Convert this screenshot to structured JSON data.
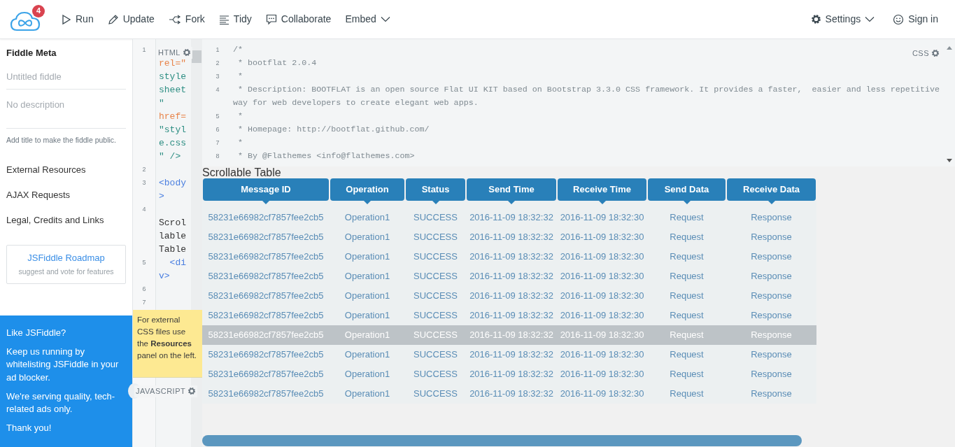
{
  "navbar": {
    "badge": "4",
    "actions": [
      {
        "label": "Run"
      },
      {
        "label": "Update"
      },
      {
        "label": "Fork"
      },
      {
        "label": "Tidy"
      },
      {
        "label": "Collaborate"
      },
      {
        "label": "Embed",
        "caret": true
      }
    ],
    "right": [
      {
        "label": "Settings",
        "caret": true
      },
      {
        "label": "Sign in"
      }
    ]
  },
  "sidebar": {
    "heading": "Fiddle Meta",
    "title_placeholder": "Untitled fiddle",
    "description_placeholder": "No description",
    "hint": "Add title to make the fiddle public.",
    "links": [
      "External Resources",
      "AJAX Requests",
      "Legal, Credits and Links"
    ],
    "roadmap": {
      "title": "JSFiddle Roadmap",
      "subtitle": "suggest and vote for features"
    }
  },
  "ad": {
    "paragraphs": [
      "Like JSFiddle?",
      "Keep us running by whitelisting JSFiddle in your ad blocker.",
      "We're serving quality, tech-related ads only.",
      "Thank you!"
    ]
  },
  "html_editor": {
    "label": "HTML",
    "lines": [
      {
        "number": "1",
        "rows": [
          {
            "kind": "blank"
          },
          {
            "kind": "attr",
            "text": "rel=\""
          },
          {
            "kind": "string",
            "text": "style"
          },
          {
            "kind": "string",
            "text": "sheet"
          },
          {
            "kind": "string",
            "text": "\""
          },
          {
            "kind": "attr",
            "text": "href="
          },
          {
            "kind": "string",
            "text": "\"styl"
          },
          {
            "kind": "string",
            "text": "e.css"
          },
          {
            "kind": "string",
            "text": "\" />"
          }
        ]
      },
      {
        "number": "2"
      },
      {
        "number": "3",
        "rows": [
          {
            "kind": "tag",
            "text": "<body"
          },
          {
            "kind": "tag",
            "text": ">"
          }
        ]
      },
      {
        "number": "4",
        "rows": [
          {
            "kind": "blank"
          },
          {
            "kind": "text",
            "text": "Scrol"
          },
          {
            "kind": "text",
            "text": "lable"
          },
          {
            "kind": "text",
            "text": "Table"
          }
        ]
      },
      {
        "number": "5",
        "rows": [
          {
            "kind": "tag",
            "text": "  <di"
          },
          {
            "kind": "tag",
            "text": "v>"
          }
        ]
      },
      {
        "number": "6"
      },
      {
        "number": "7"
      }
    ]
  },
  "tooltip": {
    "text": "For external CSS files use the **Resources** panel on the left."
  },
  "js_editor": {
    "label": "JAVASCRIPT"
  },
  "css_editor": {
    "label": "CSS",
    "lines": [
      {
        "number": "1",
        "rows": [
          "/*"
        ]
      },
      {
        "number": "2",
        "rows": [
          " * bootflat 2.0.4"
        ]
      },
      {
        "number": "3",
        "rows": [
          " *"
        ]
      },
      {
        "number": "4",
        "rows": [
          " * Description: BOOTFLAT is an open source Flat UI KIT based on Bootstrap 3.3.0 CSS framework. It provides a faster,  easier and less repetitive",
          "way for web developers to create elegant web apps."
        ]
      },
      {
        "number": "5",
        "rows": [
          " *"
        ]
      },
      {
        "number": "6",
        "rows": [
          " * Homepage: http://bootflat.github.com/"
        ]
      },
      {
        "number": "7",
        "rows": [
          " *"
        ]
      },
      {
        "number": "8",
        "rows": [
          " * By @Flathemes <info@flathemes.com>"
        ]
      }
    ]
  },
  "output": {
    "title": "Scrollable Table",
    "table": {
      "columns": [
        "Message ID",
        "Operation",
        "Status",
        "Send Time",
        "Receive Time",
        "Send Data",
        "Receive Data"
      ],
      "rows": [
        {
          "selected": false,
          "cells": [
            "58231e66982cf7857fee2cb5",
            "Operation1",
            "SUCCESS",
            "2016-11-09 18:32:32",
            "2016-11-09 18:32:30",
            "Request",
            "Response"
          ]
        },
        {
          "selected": false,
          "cells": [
            "58231e66982cf7857fee2cb5",
            "Operation1",
            "SUCCESS",
            "2016-11-09 18:32:32",
            "2016-11-09 18:32:30",
            "Request",
            "Response"
          ]
        },
        {
          "selected": false,
          "cells": [
            "58231e66982cf7857fee2cb5",
            "Operation1",
            "SUCCESS",
            "2016-11-09 18:32:32",
            "2016-11-09 18:32:30",
            "Request",
            "Response"
          ]
        },
        {
          "selected": false,
          "cells": [
            "58231e66982cf7857fee2cb5",
            "Operation1",
            "SUCCESS",
            "2016-11-09 18:32:32",
            "2016-11-09 18:32:30",
            "Request",
            "Response"
          ]
        },
        {
          "selected": false,
          "cells": [
            "58231e66982cf7857fee2cb5",
            "Operation1",
            "SUCCESS",
            "2016-11-09 18:32:32",
            "2016-11-09 18:32:30",
            "Request",
            "Response"
          ]
        },
        {
          "selected": false,
          "cells": [
            "58231e66982cf7857fee2cb5",
            "Operation1",
            "SUCCESS",
            "2016-11-09 18:32:32",
            "2016-11-09 18:32:30",
            "Request",
            "Response"
          ]
        },
        {
          "selected": true,
          "cells": [
            "58231e66982cf7857fee2cb5",
            "Operation1",
            "SUCCESS",
            "2016-11-09 18:32:32",
            "2016-11-09 18:32:30",
            "Request",
            "Response"
          ]
        },
        {
          "selected": false,
          "cells": [
            "58231e66982cf7857fee2cb5",
            "Operation1",
            "SUCCESS",
            "2016-11-09 18:32:32",
            "2016-11-09 18:32:30",
            "Request",
            "Response"
          ]
        },
        {
          "selected": false,
          "cells": [
            "58231e66982cf7857fee2cb5",
            "Operation1",
            "SUCCESS",
            "2016-11-09 18:32:32",
            "2016-11-09 18:32:30",
            "Request",
            "Response"
          ]
        },
        {
          "selected": false,
          "cells": [
            "58231e66982cf7857fee2cb5",
            "Operation1",
            "SUCCESS",
            "2016-11-09 18:32:32",
            "2016-11-09 18:32:30",
            "Request",
            "Response"
          ]
        }
      ]
    }
  }
}
